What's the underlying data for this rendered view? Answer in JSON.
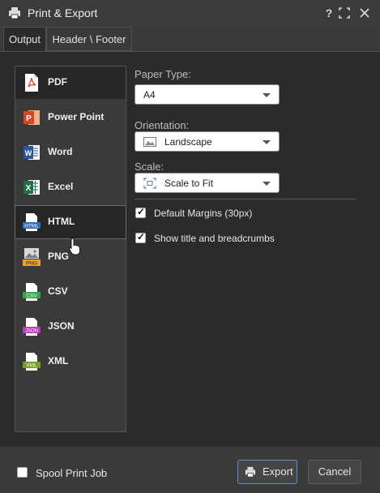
{
  "window": {
    "title": "Print & Export",
    "help_label": "?",
    "icons": {
      "title": "printer-icon",
      "help": "help-icon",
      "maximize": "maximize-icon",
      "close": "close-icon"
    }
  },
  "tabs": [
    {
      "label": "Output",
      "active": true
    },
    {
      "label": "Header \\ Footer",
      "active": false
    }
  ],
  "formats": [
    {
      "label": "PDF",
      "icon": "pdf-icon",
      "selected": true
    },
    {
      "label": "Power Point",
      "icon": "powerpoint-icon"
    },
    {
      "label": "Word",
      "icon": "word-icon"
    },
    {
      "label": "Excel",
      "icon": "excel-icon"
    },
    {
      "label": "HTML",
      "icon": "html-icon",
      "hover": true,
      "icon_text": "HTML"
    },
    {
      "label": "PNG",
      "icon": "png-icon",
      "icon_text": "PNG"
    },
    {
      "label": "CSV",
      "icon": "csv-icon",
      "icon_text": "CSV"
    },
    {
      "label": "JSON",
      "icon": "json-icon",
      "icon_text": "JSON"
    },
    {
      "label": "XML",
      "icon": "xml-icon",
      "icon_text": "XML"
    }
  ],
  "options": {
    "paper_type": {
      "label": "Paper Type:",
      "value": "A4"
    },
    "orientation": {
      "label": "Orientation:",
      "value": "Landscape",
      "icon": "landscape-image-icon"
    },
    "scale": {
      "label": "Scale:",
      "value": "Scale to Fit",
      "icon": "fit-icon"
    },
    "default_margins": {
      "label": "Default Margins (30px)",
      "checked": true
    },
    "show_title": {
      "label": "Show title and breadcrumbs",
      "checked": true
    }
  },
  "footer": {
    "spool": {
      "label": "Spool Print Job",
      "checked": false
    },
    "export_label": "Export",
    "cancel_label": "Cancel"
  },
  "colors": {
    "pdf": "#e0433a",
    "powerpoint": "#d24726",
    "word": "#2b5797",
    "excel": "#1e7145",
    "html": "#2d6db5",
    "png": "#f0a030",
    "csv": "#3aa34a",
    "json": "#b440b4",
    "xml": "#7a9a2a",
    "accent": "#5b8fd6"
  }
}
